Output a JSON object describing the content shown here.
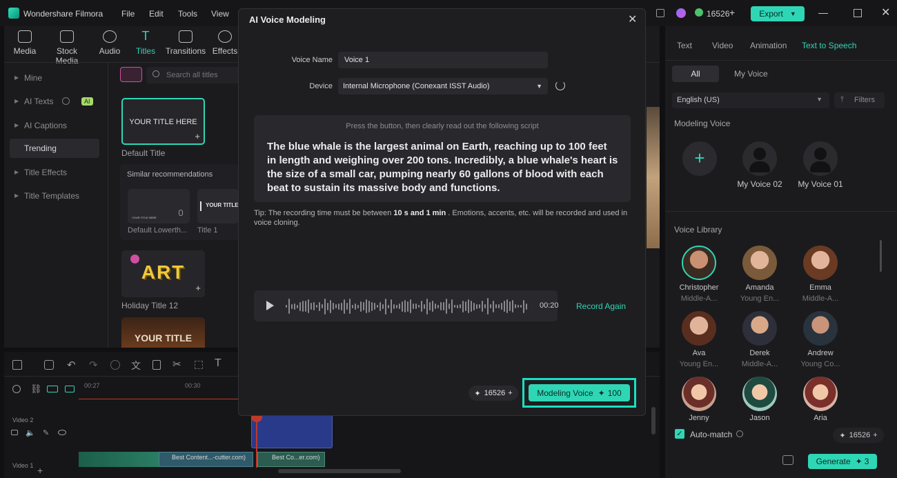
{
  "app": {
    "title": "Wondershare Filmora",
    "menu": [
      "File",
      "Edit",
      "Tools",
      "View"
    ],
    "credits": "16526",
    "export_label": "Export"
  },
  "toolbar": {
    "items": [
      "Media",
      "Stock Media",
      "Audio",
      "Titles",
      "Transitions",
      "Effects"
    ],
    "active": "Titles"
  },
  "sidebar": {
    "items": [
      "Mine",
      "AI Texts",
      "AI Captions",
      "Trending",
      "Title Effects",
      "Title Templates"
    ],
    "ai_badge": "AI",
    "selected": "Trending"
  },
  "titles_panel": {
    "search_placeholder": "Search all titles",
    "default_card_text": "YOUR TITLE HERE",
    "default_card_label": "Default Title",
    "similar_heading": "Similar recommendations",
    "similar_items": [
      "Default Lowerth...",
      "Title 1"
    ],
    "similar_thumb_text": [
      "YOUR TITLE HERE",
      "YOUR TITLE"
    ],
    "holiday_text": "ART",
    "holiday_label": "Holiday Title 12",
    "bottom_card_text": "YOUR TITLE"
  },
  "timeline": {
    "timecodes": [
      "00:27",
      "00:30"
    ],
    "track_video2": "Video 2",
    "track_video1": "Video 1",
    "clip1": "Best Content...-cutter.com)",
    "clip2": "Best Co...er.com)"
  },
  "modal": {
    "title": "AI Voice Modeling",
    "voice_name_label": "Voice Name",
    "voice_name_value": "Voice 1",
    "device_label": "Device",
    "device_value": "Internal Microphone (Conexant ISST Audio)",
    "script_instruction": "Press the button, then clearly read out the following script",
    "script_text": "The blue whale is the largest animal on Earth, reaching up to 100 feet in length and weighing over 200 tons. Incredibly, a blue whale's heart is the size of a small car, pumping nearly 60 gallons of blood with each beat to sustain its massive body and functions.",
    "tip_prefix": "Tip: The recording time must be between ",
    "tip_bold": "10 s and 1 min",
    "tip_suffix": " . Emotions, accents, etc. will be recorded and used in voice cloning.",
    "duration": "00:20",
    "record_again_label": "Record Again",
    "credits": "16526",
    "modeling_button_label": "Modeling Voice",
    "modeling_cost": "100"
  },
  "right_panel": {
    "tabs": [
      "Text",
      "Video",
      "Animation",
      "Text to Speech"
    ],
    "active_tab": "Text to Speech",
    "filter_tabs": [
      "All",
      "My Voice"
    ],
    "language": "English (US)",
    "filters_label": "Filters",
    "modeling_heading": "Modeling Voice",
    "my_voices": [
      "My Voice 02",
      "My Voice 01"
    ],
    "library_heading": "Voice Library",
    "voices": [
      {
        "name": "Christopher",
        "desc": "Middle-A..."
      },
      {
        "name": "Amanda",
        "desc": "Young En..."
      },
      {
        "name": "Emma",
        "desc": "Middle-A..."
      },
      {
        "name": "Ava",
        "desc": "Young En..."
      },
      {
        "name": "Derek",
        "desc": "Middle-A..."
      },
      {
        "name": "Andrew",
        "desc": "Young Co..."
      },
      {
        "name": "Jenny",
        "desc": ""
      },
      {
        "name": "Jason",
        "desc": ""
      },
      {
        "name": "Aria",
        "desc": ""
      }
    ],
    "auto_match_label": "Auto-match",
    "credits": "16526",
    "generate_label": "Generate",
    "generate_cost": "3"
  },
  "colors": {
    "accent": "#2fd6b5",
    "highlight_border": "#19e0c0",
    "background": "#101012",
    "modal_bg": "#1e1e21"
  }
}
